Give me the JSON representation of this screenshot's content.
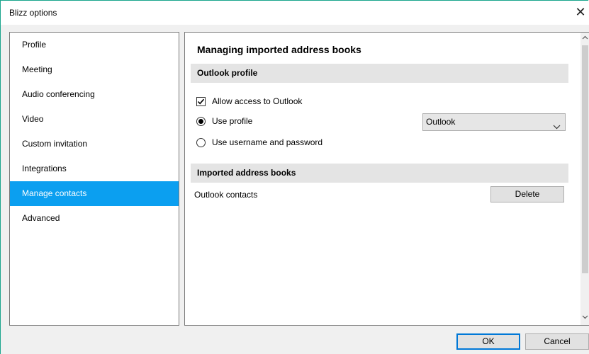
{
  "window": {
    "title": "Blizz options"
  },
  "sidebar": {
    "items": [
      {
        "label": "Profile"
      },
      {
        "label": "Meeting"
      },
      {
        "label": "Audio conferencing"
      },
      {
        "label": "Video"
      },
      {
        "label": "Custom invitation"
      },
      {
        "label": "Integrations"
      },
      {
        "label": "Manage contacts",
        "selected": true
      },
      {
        "label": "Advanced"
      }
    ]
  },
  "main": {
    "title": "Managing imported address books",
    "outlook_section": {
      "heading": "Outlook profile",
      "allow_access": {
        "label": "Allow access to Outlook",
        "checked": true
      },
      "use_profile": {
        "label": "Use profile",
        "selected": true
      },
      "use_credentials": {
        "label": "Use username and password",
        "selected": false
      },
      "profile_select": {
        "value": "Outlook"
      }
    },
    "address_books_section": {
      "heading": "Imported address books",
      "entries": [
        {
          "name": "Outlook contacts",
          "action_label": "Delete"
        }
      ]
    }
  },
  "footer": {
    "ok_label": "OK",
    "cancel_label": "Cancel"
  },
  "colors": {
    "accent": "#0b9ff0",
    "window_border": "#1aa58c"
  }
}
